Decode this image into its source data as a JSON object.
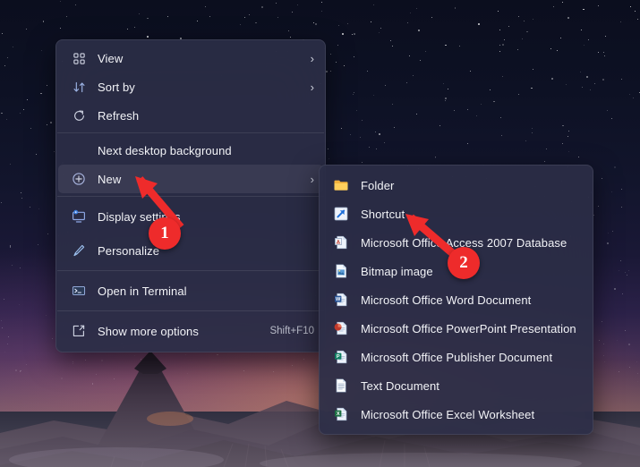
{
  "desktop": {
    "wallpaper_name": "starry-night-volcano-wallpaper",
    "sky_color": "#0b0e1e",
    "horizon_glow_color": "#ff9650",
    "mountain_color": "#2a2030"
  },
  "context_menu": {
    "name": "desktop-context-menu",
    "items": [
      {
        "id": "view",
        "label": "View",
        "icon": "grid-icon",
        "submenu": true,
        "selected": false,
        "accel": ""
      },
      {
        "id": "sort-by",
        "label": "Sort by",
        "icon": "sort-icon",
        "submenu": true,
        "selected": false,
        "accel": ""
      },
      {
        "id": "refresh",
        "label": "Refresh",
        "icon": "refresh-icon",
        "submenu": false,
        "selected": false,
        "accel": ""
      },
      {
        "id": "separator-1",
        "label": "",
        "icon": "separator",
        "submenu": false,
        "selected": false,
        "accel": ""
      },
      {
        "id": "next-desktop-background",
        "label": "Next desktop background",
        "icon": "none",
        "submenu": false,
        "selected": false,
        "accel": ""
      },
      {
        "id": "new",
        "label": "New",
        "icon": "plus-circle-icon",
        "submenu": true,
        "selected": true,
        "accel": ""
      },
      {
        "id": "separator-2",
        "label": "",
        "icon": "separator",
        "submenu": false,
        "selected": false,
        "accel": ""
      },
      {
        "id": "display-settings",
        "label": "Display settings",
        "icon": "monitor-icon",
        "submenu": false,
        "selected": false,
        "accel": ""
      },
      {
        "id": "personalize",
        "label": "Personalize",
        "icon": "brush-icon",
        "submenu": false,
        "selected": false,
        "accel": ""
      },
      {
        "id": "separator-3",
        "label": "",
        "icon": "separator",
        "submenu": false,
        "selected": false,
        "accel": ""
      },
      {
        "id": "open-in-terminal",
        "label": "Open in Terminal",
        "icon": "terminal-icon",
        "submenu": false,
        "selected": false,
        "accel": ""
      },
      {
        "id": "separator-4",
        "label": "",
        "icon": "separator",
        "submenu": false,
        "selected": false,
        "accel": ""
      },
      {
        "id": "show-more-options",
        "label": "Show more options",
        "icon": "expand-icon",
        "submenu": false,
        "selected": false,
        "accel": "Shift+F10"
      }
    ]
  },
  "new_submenu": {
    "name": "new-submenu",
    "items": [
      {
        "id": "folder",
        "label": "Folder",
        "icon": "folder-icon"
      },
      {
        "id": "shortcut",
        "label": "Shortcut",
        "icon": "shortcut-icon"
      },
      {
        "id": "access-db",
        "label": "Microsoft Office Access 2007 Database",
        "icon": "access-file-icon"
      },
      {
        "id": "bitmap",
        "label": "Bitmap image",
        "icon": "bitmap-file-icon"
      },
      {
        "id": "word-doc",
        "label": "Microsoft Office Word Document",
        "icon": "word-file-icon"
      },
      {
        "id": "powerpoint",
        "label": "Microsoft Office PowerPoint Presentation",
        "icon": "powerpoint-file-icon"
      },
      {
        "id": "publisher",
        "label": "Microsoft Office Publisher Document",
        "icon": "publisher-file-icon"
      },
      {
        "id": "text-doc",
        "label": "Text Document",
        "icon": "text-file-icon"
      },
      {
        "id": "excel",
        "label": "Microsoft Office Excel Worksheet",
        "icon": "excel-file-icon"
      }
    ]
  },
  "annotations": {
    "color": "#ee2b2b",
    "markers": [
      {
        "id": "marker-1",
        "label": "1",
        "points_to": "New"
      },
      {
        "id": "marker-2",
        "label": "2",
        "points_to": "Shortcut"
      }
    ]
  }
}
